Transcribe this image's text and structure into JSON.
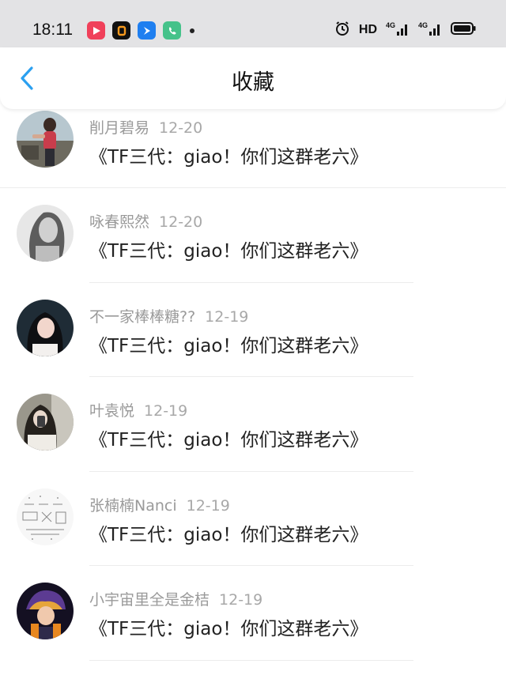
{
  "status_bar": {
    "time": "18:11",
    "hd_label": "HD",
    "network_labels": [
      "4G",
      "4G"
    ],
    "icons": [
      "video-app-icon",
      "orange-app-icon",
      "blue-app-icon",
      "phone-app-icon",
      "notification-dot-icon",
      "alarm-icon",
      "hd-icon",
      "signal-icon",
      "signal-icon",
      "battery-icon"
    ]
  },
  "header": {
    "title": "收藏",
    "back_icon": "chevron-left-icon",
    "accent_color": "#2ba0f0"
  },
  "items": [
    {
      "name": "削月碧易",
      "date": "12-20",
      "message": "《TF三代：giao！你们这群老六》"
    },
    {
      "name": "咏春熙然",
      "date": "12-20",
      "message": "《TF三代：giao！你们这群老六》"
    },
    {
      "name": "不一家棒棒糖??",
      "date": "12-19",
      "message": "《TF三代：giao！你们这群老六》"
    },
    {
      "name": "叶袁悦",
      "date": "12-19",
      "message": "《TF三代：giao！你们这群老六》"
    },
    {
      "name": "张楠楠Nanci",
      "date": "12-19",
      "message": "《TF三代：giao！你们这群老六》"
    },
    {
      "name": "小宇宙里全是金桔",
      "date": "12-19",
      "message": "《TF三代：giao！你们这群老六》"
    }
  ]
}
